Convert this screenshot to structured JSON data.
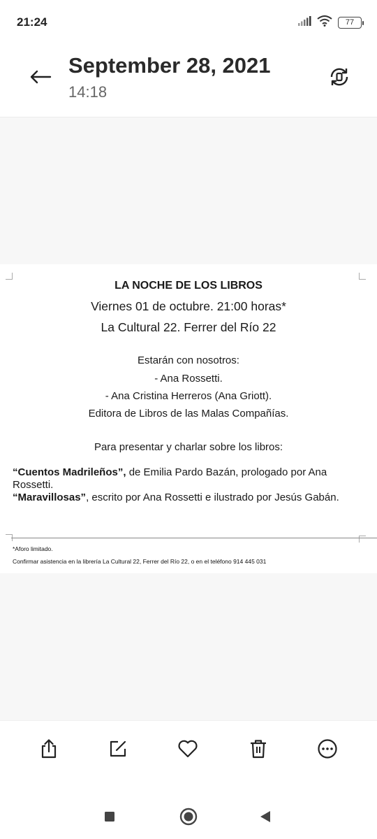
{
  "status_bar": {
    "time": "21:24",
    "battery": "77",
    "icons": [
      "signal-icon",
      "wifi-icon",
      "battery-icon"
    ]
  },
  "header": {
    "title": "September 28, 2021",
    "subtitle": "14:18",
    "back_icon": "arrow-left-icon",
    "rotate_icon": "rotate-icon"
  },
  "document": {
    "title": "LA NOCHE DE LOS LIBROS",
    "date_line": "Viernes 01 de octubre. 21:00 horas*",
    "place_line": "La Cultural 22. Ferrer del Río 22",
    "guests_heading": "Estarán con nosotros:",
    "guest_1": "-  Ana Rossetti.",
    "guest_2": "-  Ana Cristina Herreros (Ana Griott).",
    "guest_2_role": "Editora de Libros de las Malas Compañías.",
    "present_heading": "Para presentar y charlar sobre los libros:",
    "book_1_title": "“Cuentos Madrileños”,",
    "book_1_rest": " de Emilia Pardo Bazán, prologado por Ana",
    "book_1_rest_2": "Rossetti.",
    "book_2_title": "“Maravillosas”",
    "book_2_rest": ", escrito por Ana Rossetti e ilustrado por Jesús Gabán.",
    "footnote_1": "*Aforo limitado.",
    "footnote_2": "Confirmar asistencia en la librería La Cultural 22, Ferrer del Río 22, o en el teléfono 914 445 031"
  },
  "toolbar": {
    "icons": [
      "share-icon",
      "edit-icon",
      "heart-icon",
      "trash-icon",
      "more-icon"
    ]
  },
  "navbar": {
    "icons": [
      "recents-square-icon",
      "home-circle-icon",
      "back-triangle-icon"
    ]
  }
}
